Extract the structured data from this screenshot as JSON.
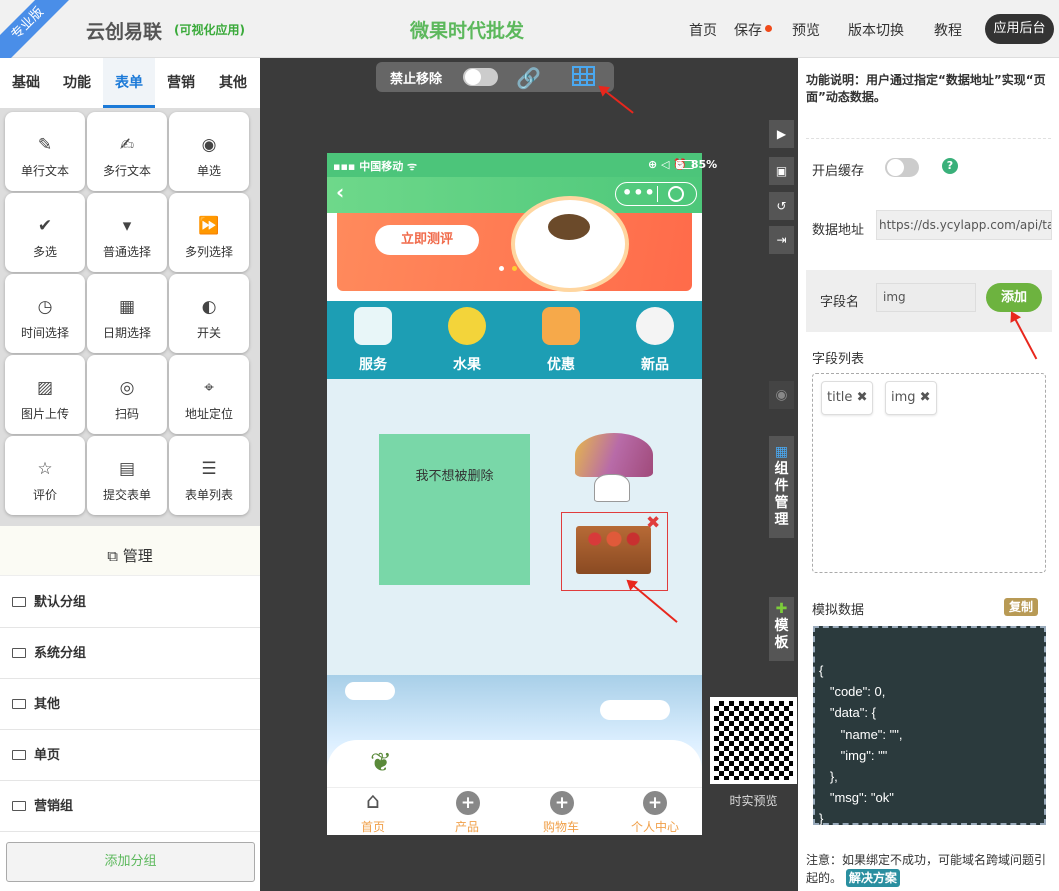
{
  "header": {
    "ribbon": "专业版",
    "logo": "云创易联",
    "logo_sub": "(可视化应用)",
    "app_title": "微果时代批发",
    "nav": [
      "首页",
      "保存",
      "预览",
      "版本切换",
      "教程"
    ],
    "admin": "应用后台"
  },
  "left": {
    "tabs": [
      "基础",
      "功能",
      "表单",
      "营销",
      "其他"
    ],
    "active_tab": "表单",
    "components": [
      {
        "label": "单行文本",
        "icon": "pencil-icon"
      },
      {
        "label": "多行文本",
        "icon": "edit-icon"
      },
      {
        "label": "单选",
        "icon": "radio-icon"
      },
      {
        "label": "多选",
        "icon": "check-circle-icon"
      },
      {
        "label": "普通选择",
        "icon": "caret-down-icon"
      },
      {
        "label": "多列选择",
        "icon": "fast-forward-icon"
      },
      {
        "label": "时间选择",
        "icon": "clock-icon"
      },
      {
        "label": "日期选择",
        "icon": "calendar-icon"
      },
      {
        "label": "开关",
        "icon": "toggle-icon"
      },
      {
        "label": "图片上传",
        "icon": "image-icon"
      },
      {
        "label": "扫码",
        "icon": "camera-icon"
      },
      {
        "label": "地址定位",
        "icon": "map-pin-icon"
      },
      {
        "label": "评价",
        "icon": "star-icon"
      },
      {
        "label": "提交表单",
        "icon": "save-icon"
      },
      {
        "label": "表单列表",
        "icon": "list-icon"
      }
    ],
    "manage": "管理",
    "groups": [
      "默认分组",
      "系统分组",
      "其他",
      "单页",
      "营销组"
    ],
    "add_group": "添加分组"
  },
  "toolbar": {
    "lock_label": "禁止移除"
  },
  "phone": {
    "carrier": "中国移动",
    "battery": "85%",
    "banner_button": "立即测评",
    "nav": [
      "服务",
      "水果",
      "优惠",
      "新品"
    ],
    "keep_text": "我不想被删除",
    "tabbar": [
      "首页",
      "产品",
      "购物车",
      "个人中心"
    ]
  },
  "side": {
    "component_manage": "组件管理",
    "template": "模板",
    "qr_label": "时实预览"
  },
  "right": {
    "func_desc": "功能说明：用户通过指定“数据地址”实现“页面”动态数据。",
    "cache_label": "开启缓存",
    "url_label": "数据地址",
    "url_value": "https://ds.ycylapp.com/api/tabc/t",
    "field_label": "字段名",
    "field_value": "img",
    "add_button": "添加",
    "list_label": "字段列表",
    "fields": [
      "title",
      "img"
    ],
    "mock_label": "模拟数据",
    "copy_button": "复制",
    "mock_code": "{\n   \"code\": 0,\n   \"data\": {\n      \"name\": \"\",\n      \"img\": \"\"\n   },\n   \"msg\": \"ok\"\n}",
    "note": "注意：如果绑定不成功，可能域名跨域问题引起的。",
    "fix_button": "解决方案"
  },
  "colors": {
    "accent": "#1c7ad8",
    "green": "#5cb85c",
    "phone_header": "#4cc57a",
    "nav_strip": "#1d9eb4",
    "arrow": "#e8271d"
  }
}
